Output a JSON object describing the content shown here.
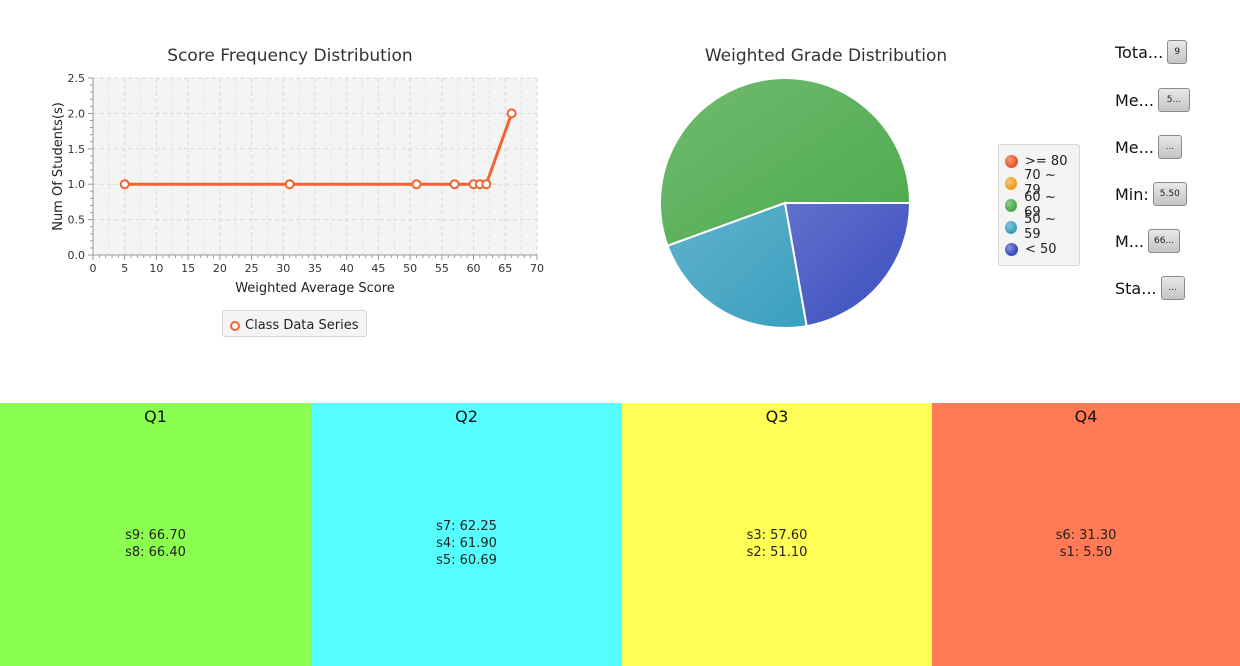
{
  "line_chart": {
    "title": "Score Frequency Distribution",
    "legend_label": "Class Data Series",
    "series_color": "#f4622f"
  },
  "pie_chart": {
    "title": "Weighted Grade Distribution"
  },
  "stats": [
    {
      "label": "Tota...",
      "value": "9"
    },
    {
      "label": "Me...",
      "value": "5..."
    },
    {
      "label": "Me...",
      "value": "..."
    },
    {
      "label": "Min:",
      "value": "5.50"
    },
    {
      "label": "M...",
      "value": "66..."
    },
    {
      "label": "Sta...",
      "value": "..."
    }
  ],
  "quartiles": [
    {
      "title": "Q1",
      "color": "#8aff50",
      "items": [
        "s9: 66.70",
        "s8: 66.40"
      ]
    },
    {
      "title": "Q2",
      "color": "#55ffff",
      "items": [
        "s7: 62.25",
        "s4: 61.90",
        "s5: 60.69"
      ]
    },
    {
      "title": "Q3",
      "color": "#ffff55",
      "items": [
        "s3: 57.60",
        "s2: 51.10"
      ]
    },
    {
      "title": "Q4",
      "color": "#ff7a55",
      "items": [
        "s6: 31.30",
        "s1: 5.50"
      ]
    }
  ],
  "chart_data": [
    {
      "type": "line",
      "title": "Score Frequency Distribution",
      "xlabel": "Weighted Average Score",
      "ylabel": "Num Of Students(s)",
      "xlim": [
        0,
        70
      ],
      "ylim": [
        0,
        2.5
      ],
      "x_ticks": [
        0,
        5,
        10,
        15,
        20,
        25,
        30,
        35,
        40,
        45,
        50,
        55,
        60,
        65,
        70
      ],
      "y_ticks": [
        0.0,
        0.5,
        1.0,
        1.5,
        2.0,
        2.5
      ],
      "grid": true,
      "legend": "bottom",
      "series": [
        {
          "name": "Class Data Series",
          "color": "#f4622f",
          "x": [
            5,
            31,
            51,
            57,
            60,
            61,
            62,
            66
          ],
          "y": [
            1,
            1,
            1,
            1,
            1,
            1,
            1,
            2
          ]
        }
      ]
    },
    {
      "type": "pie",
      "title": "Weighted Grade Distribution",
      "legend": "right",
      "categories": [
        ">= 80",
        "70 ~ 79",
        "60 ~ 69",
        "50 ~ 59",
        "< 50"
      ],
      "values": [
        0,
        0,
        5,
        2,
        2
      ],
      "colors": [
        "#e8572d",
        "#f0a020",
        "#4caa4c",
        "#3a9fbf",
        "#3a4dbf"
      ]
    }
  ]
}
